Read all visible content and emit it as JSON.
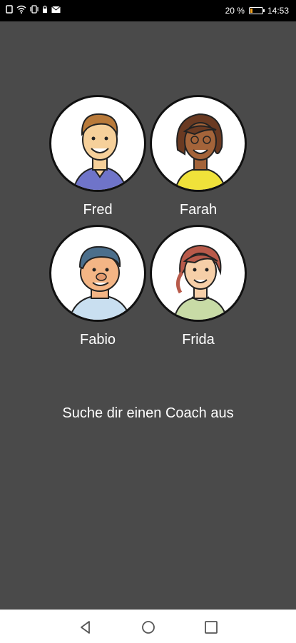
{
  "status_bar": {
    "battery_percent": "20 %",
    "battery_level": 0.2,
    "time": "14:53",
    "icons": [
      "sim-icon",
      "wifi-icon",
      "vibrate-icon",
      "lock-icon",
      "mail-icon"
    ]
  },
  "coaches": [
    {
      "name": "Fred"
    },
    {
      "name": "Farah"
    },
    {
      "name": "Fabio"
    },
    {
      "name": "Frida"
    }
  ],
  "prompt": "Suche dir einen Coach aus",
  "nav": {
    "icons": [
      "back-icon",
      "home-icon",
      "recents-icon"
    ]
  }
}
